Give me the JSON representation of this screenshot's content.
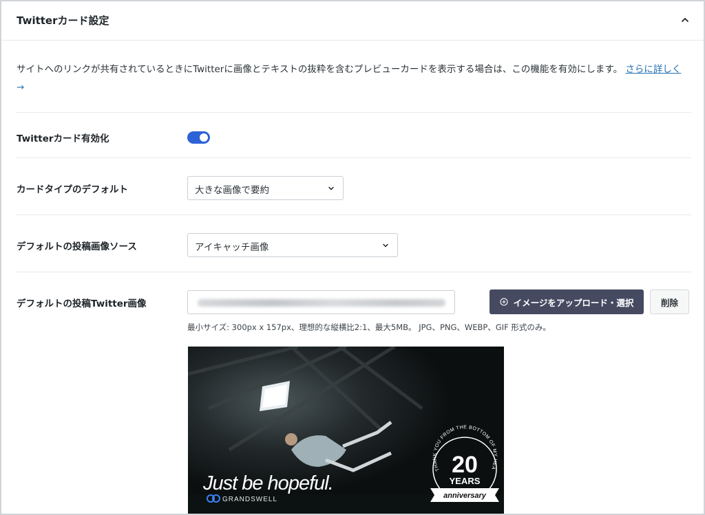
{
  "header": {
    "title": "Twitterカード設定"
  },
  "description": {
    "text": "サイトへのリンクが共有されているときにTwitterに画像とテキストの抜粋を含むプレビューカードを表示する場合は、この機能を有効にします。",
    "link_text": "さらに詳しく",
    "link_arrow": "→"
  },
  "rows": {
    "enable": {
      "label": "Twitterカード有効化",
      "enabled": true
    },
    "card_type": {
      "label": "カードタイプのデフォルト",
      "value": "大きな画像で要約"
    },
    "image_source": {
      "label": "デフォルトの投稿画像ソース",
      "value": "アイキャッチ画像"
    },
    "twitter_image": {
      "label": "デフォルトの投稿Twitter画像",
      "upload_label": "イメージをアップロード・選択",
      "delete_label": "削除",
      "hint": "最小サイズ: 300px x 157px、理想的な縦横比2:1、最大5MB。 JPG、PNG、WEBP、GIF 形式のみ。"
    }
  },
  "preview": {
    "tagline": "Just be hopeful.",
    "brand": "GRANDSWELL",
    "badge_number": "20",
    "badge_years": "YEARS",
    "badge_ribbon": "anniversary",
    "badge_arc": "THANK YOU FROM THE BOTTOM OF MY HEART"
  },
  "colors": {
    "toggle_on": "#2c62d6",
    "primary_button": "#454a61",
    "link": "#2271b1"
  }
}
